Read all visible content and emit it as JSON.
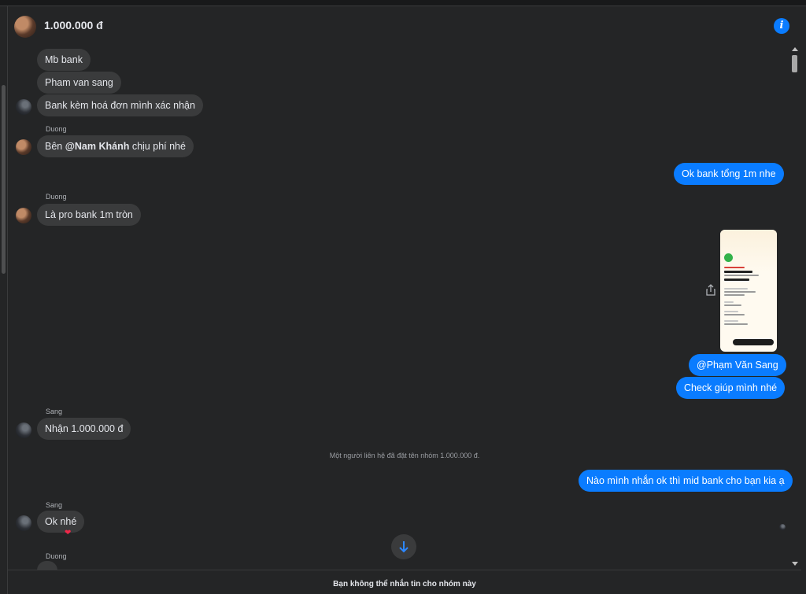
{
  "conversation": {
    "title": "1.000.000 đ",
    "info_icon": "info-icon"
  },
  "messages": {
    "m1": "Mb bank",
    "m2": "Pham van sang",
    "m3": "Bank kèm hoá đơn mình xác nhận",
    "sender_duong_1": "Duong",
    "m4_prefix": "Bên ",
    "m4_mention": "@Nam Khánh",
    "m4_suffix": " chịu phí nhé",
    "m5": "Ok bank tổng 1m nhe",
    "sender_duong_2": "Duong",
    "m6": "Là pro bank 1m tròn",
    "m7": "@Phạm Văn Sang",
    "m8": "Check giúp mình nhé",
    "sender_sang_1": "Sang",
    "m9": "Nhận 1.000.000 đ",
    "system_note": "Một người liên hệ đã đặt tên nhóm 1.000.000 đ.",
    "m10": "Nào mình nhắn ok thì mid bank cho bạn kia ạ",
    "sender_sang_2": "Sang",
    "m11": "Ok nhé",
    "reaction": "❤",
    "sender_duong_3": "Duong"
  },
  "footer": {
    "title": "Bạn không thể nhắn tin cho nhóm này"
  },
  "icons": {
    "scroll_down": "arrow-down-icon",
    "share": "share-icon"
  },
  "colors": {
    "outgoing_bubble": "#0a7cff",
    "incoming_bubble": "#3a3b3c",
    "background": "#242526"
  }
}
